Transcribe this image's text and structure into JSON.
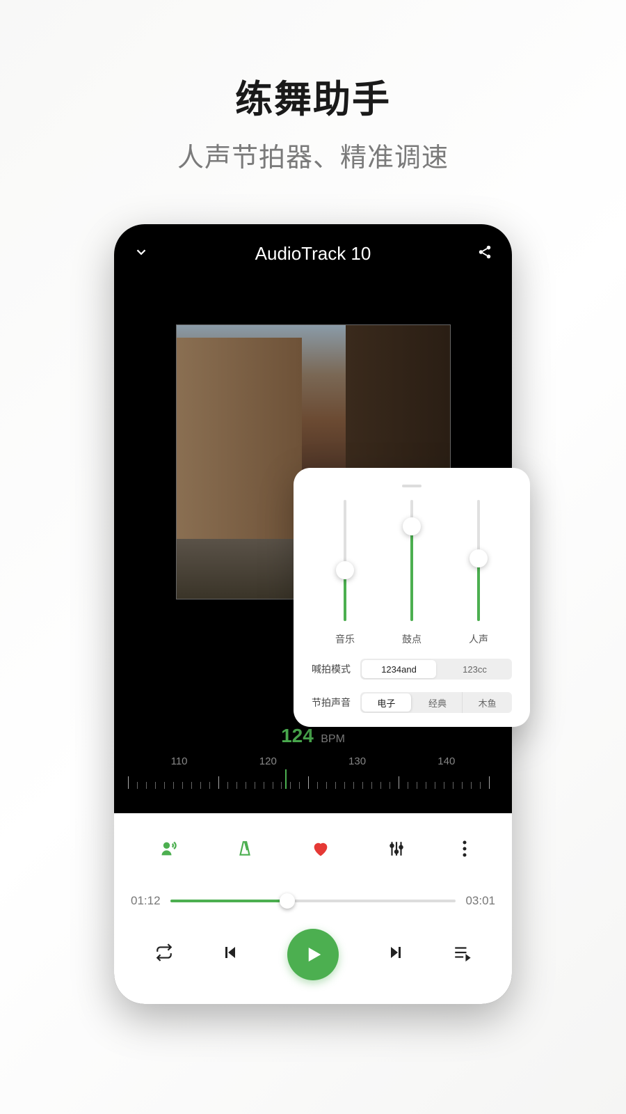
{
  "marketing": {
    "title": "练舞助手",
    "subtitle": "人声节拍器、精准调速"
  },
  "player": {
    "track_title": "AudioTrack 10",
    "bpm_value": "124",
    "bpm_unit": "BPM",
    "ruler_labels": [
      "110",
      "120",
      "130",
      "140"
    ],
    "time_elapsed": "01:12",
    "time_total": "03:01"
  },
  "mixer": {
    "sliders": [
      {
        "label": "音乐",
        "value_pct": 42
      },
      {
        "label": "鼓点",
        "value_pct": 78
      },
      {
        "label": "人声",
        "value_pct": 52
      }
    ],
    "count_mode_label": "喊拍模式",
    "count_mode_options": [
      "1234and",
      "123cc"
    ],
    "count_mode_active": 0,
    "beat_sound_label": "节拍声音",
    "beat_sound_options": [
      "电子",
      "经典",
      "木鱼"
    ],
    "beat_sound_active": 0
  }
}
